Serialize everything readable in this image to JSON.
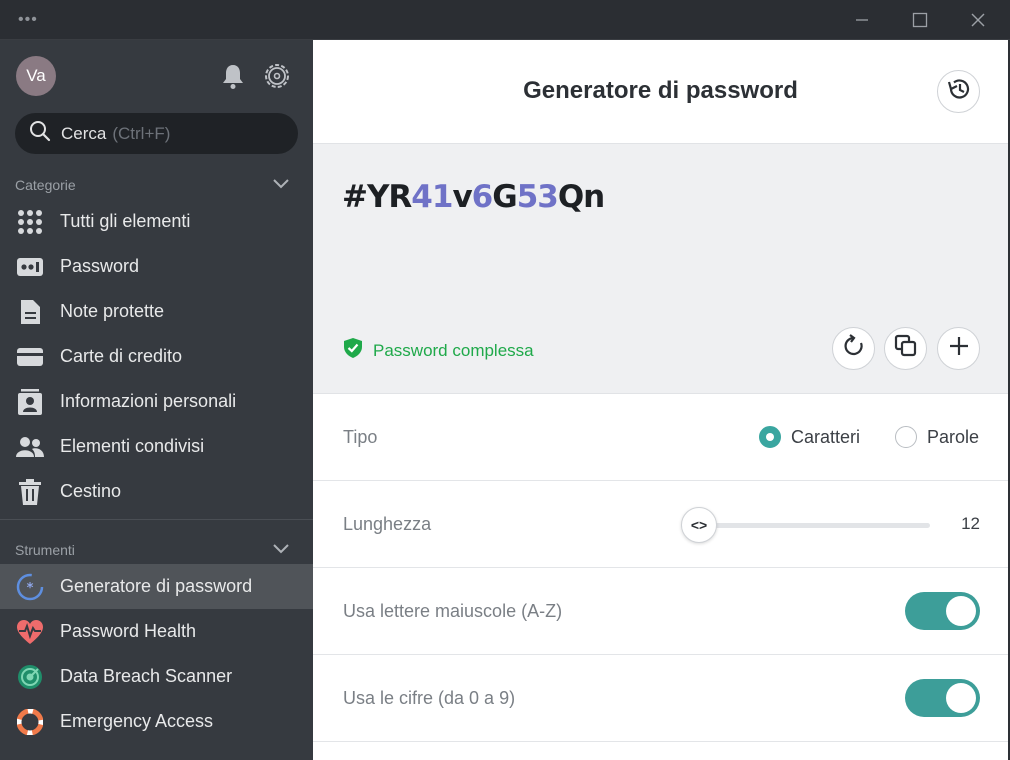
{
  "window": {
    "menu_glyph": "•••",
    "min_icon": "minimize-icon",
    "max_icon": "maximize-icon",
    "close_icon": "close-icon"
  },
  "sidebar": {
    "avatar_initials": "Va",
    "search": {
      "placeholder": "Cerca",
      "shortcut": "(Ctrl+F)"
    },
    "categories_label": "Categorie",
    "categories": [
      {
        "label": "Tutti gli elementi",
        "icon": "grid-icon"
      },
      {
        "label": "Password",
        "icon": "password-icon"
      },
      {
        "label": "Note protette",
        "icon": "document-icon"
      },
      {
        "label": "Carte di credito",
        "icon": "credit-card-icon"
      },
      {
        "label": "Informazioni personali",
        "icon": "contact-card-icon"
      },
      {
        "label": "Elementi condivisi",
        "icon": "people-icon"
      },
      {
        "label": "Cestino",
        "icon": "trash-icon"
      }
    ],
    "tools_label": "Strumenti",
    "tools": [
      {
        "label": "Generatore di password",
        "icon": "password-generator-icon",
        "active": true
      },
      {
        "label": "Password Health",
        "icon": "heartbeat-icon"
      },
      {
        "label": "Data Breach Scanner",
        "icon": "radar-icon"
      },
      {
        "label": "Emergency Access",
        "icon": "lifebuoy-icon"
      }
    ]
  },
  "main": {
    "title": "Generatore di password",
    "password": {
      "segments": [
        {
          "text": "#YR",
          "digit": false
        },
        {
          "text": "41",
          "digit": true
        },
        {
          "text": "v",
          "digit": false
        },
        {
          "text": "6",
          "digit": true
        },
        {
          "text": "G",
          "digit": false
        },
        {
          "text": "53",
          "digit": true
        },
        {
          "text": "Qn",
          "digit": false
        }
      ]
    },
    "strength_text": "Password complessa",
    "type_row": {
      "label": "Tipo",
      "option_chars": "Caratteri",
      "option_words": "Parole",
      "selected": "Caratteri"
    },
    "length_row": {
      "label": "Lunghezza",
      "value": "12",
      "thumb_glyph": "<>"
    },
    "uppercase_row": {
      "label": "Usa lettere maiuscole (A-Z)",
      "enabled": true
    },
    "digits_row": {
      "label": "Usa le cifre (da 0 a 9)",
      "enabled": true
    }
  },
  "colors": {
    "accent": "#3d9e99",
    "digit": "#6f72c7",
    "strength": "#1fa94a",
    "sidebar": "#363a40"
  }
}
